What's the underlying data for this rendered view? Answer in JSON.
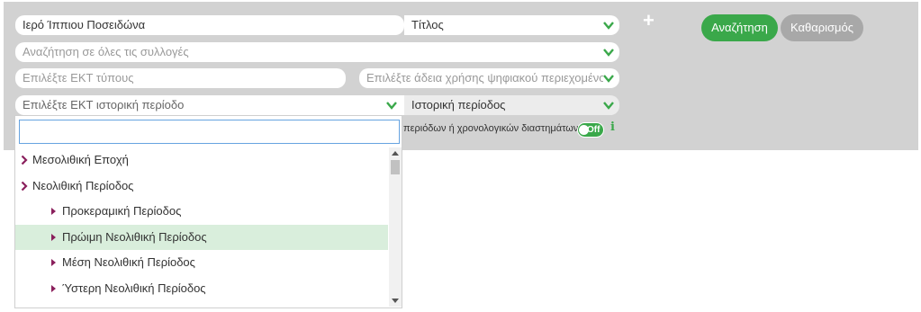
{
  "search_form": {
    "keyword_value": "Ιερό Ίππιου Ποσειδώνα",
    "field_select": "Τίτλος",
    "collections_placeholder": "Αναζήτηση σε όλες τις συλλογές",
    "ekt_type_placeholder": "Επιλέξτε ΕΚΤ τύπους",
    "license_placeholder": "Επιλέξτε άδεια χρήσης ψηφιακού περιεχομένου",
    "period_placeholder": "Επιλέξτε ΕΚΤ ιστορική περίοδο",
    "period_select": "Ιστορική περίοδος",
    "search_button": "Αναζήτηση",
    "clear_button": "Καθαρισμός",
    "add_icon": "+",
    "periods_note": "περιόδων ή χρονολογικών διαστημάτων",
    "toggle_label": "Off",
    "info_icon": "i"
  },
  "dropdown": {
    "search_value": "",
    "items": [
      {
        "label": "Μεσολιθική Εποχή",
        "level": 0
      },
      {
        "label": "Νεολιθική Περίοδος",
        "level": 0
      },
      {
        "label": "Προκεραμική Περίοδος",
        "level": 1
      },
      {
        "label": "Πρώιμη Νεολιθική Περίοδος",
        "level": 1,
        "highlighted": true
      },
      {
        "label": "Μέση Νεολιθική Περίοδος",
        "level": 1
      },
      {
        "label": "Ύστερη Νεολιθική Περίοδος",
        "level": 1
      }
    ]
  },
  "colors": {
    "accent_green": "#3aa84a",
    "panel_gray": "#d2d2d2",
    "item_arrow": "#8a1f5c",
    "highlight": "#d9eedc"
  }
}
